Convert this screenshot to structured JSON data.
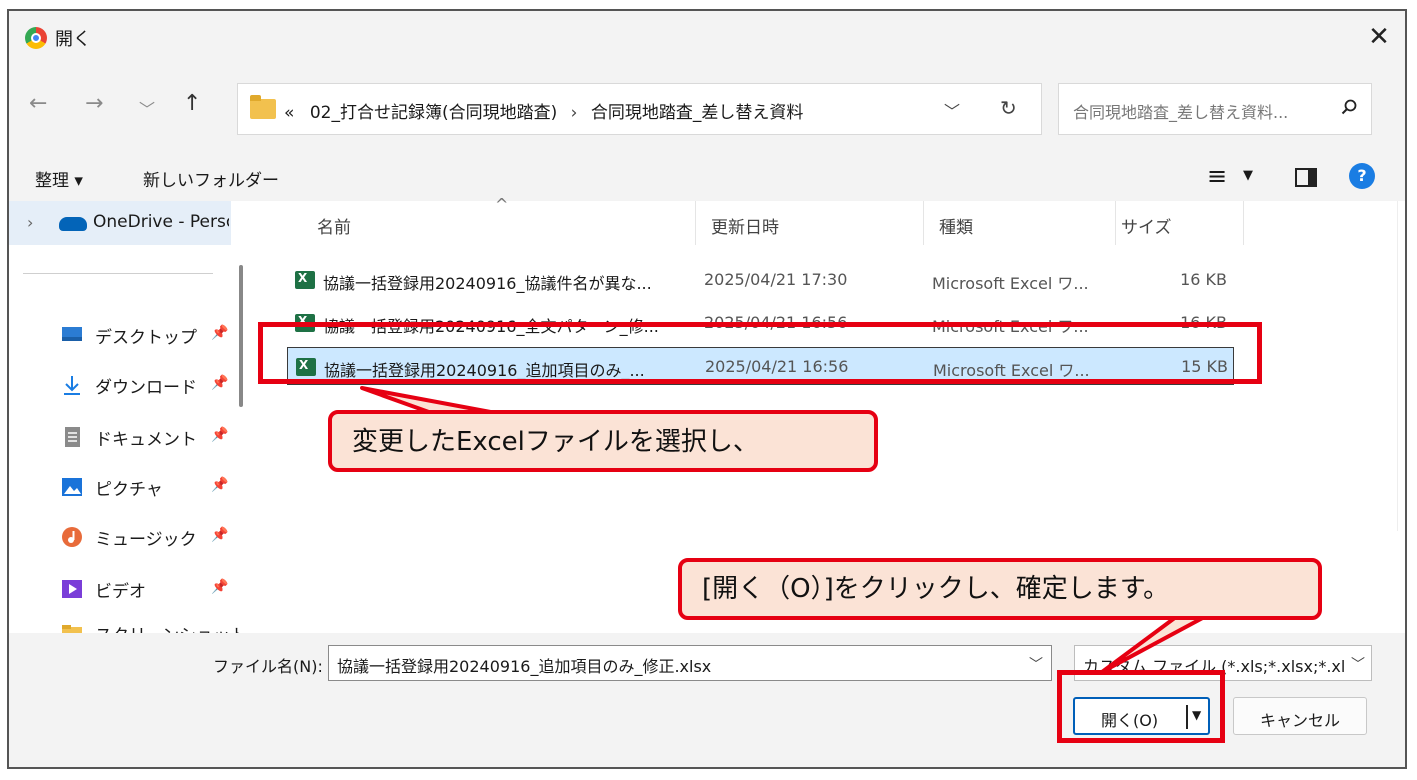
{
  "window": {
    "title": "開く",
    "close_glyph": "✕"
  },
  "nav_buttons": {
    "back": "←",
    "forward": "→",
    "history": "﹀",
    "up": "↑"
  },
  "address": {
    "prefix": "«",
    "crumbs": [
      "02_打合せ記録簿(合同現地踏査)",
      "合同現地踏査_差し替え資料"
    ],
    "separator": "›",
    "dropdown": "﹀",
    "refresh": "↻"
  },
  "search": {
    "placeholder": "合同現地踏査_差し替え資料..."
  },
  "toolbar": {
    "organize": "整理 ▾",
    "new_folder": "新しいフォルダー",
    "view_icon": "≡",
    "view_dropdown": "▼",
    "help": "?"
  },
  "nav_pane": {
    "onedrive_chevron": "›",
    "onedrive": "OneDrive - Personal",
    "quick_access": [
      {
        "label": "デスクトップ",
        "icon": "desktop-icon",
        "color": "#2b7cd3"
      },
      {
        "label": "ダウンロード",
        "icon": "download-icon",
        "color": "#1a7de3"
      },
      {
        "label": "ドキュメント",
        "icon": "documents-icon",
        "color": "#8a8a8a"
      },
      {
        "label": "ピクチャ",
        "icon": "pictures-icon",
        "color": "#1a73d9"
      },
      {
        "label": "ミュージック",
        "icon": "music-icon",
        "color": "#e86b3a"
      },
      {
        "label": "ビデオ",
        "icon": "video-icon",
        "color": "#7a3ed8"
      },
      {
        "label": "スクリーンショット",
        "icon": "folder-icon",
        "color": "#f2c14e"
      }
    ],
    "pin_glyph": "📌"
  },
  "columns": {
    "name": "名前",
    "modified": "更新日時",
    "type": "種類",
    "size": "サイズ",
    "sort_caret": "^"
  },
  "files": [
    {
      "name": "協議一括登録用20240916_協議件名が異な...",
      "modified": "2025/04/21 17:30",
      "type": "Microsoft Excel ワ...",
      "size": "16 KB",
      "selected": false
    },
    {
      "name": "協議一括登録用20240916_全文パターン_修...",
      "modified": "2025/04/21 16:56",
      "type": "Microsoft Excel ワ...",
      "size": "16 KB",
      "selected": false
    },
    {
      "name": "協議一括登録用20240916_追加項目のみ_...",
      "modified": "2025/04/21 16:56",
      "type": "Microsoft Excel ワ...",
      "size": "15 KB",
      "selected": true
    }
  ],
  "bottom": {
    "filename_label": "ファイル名(N):",
    "filename_value": "協議一括登録用20240916_追加項目のみ_修正.xlsx",
    "filetype_value": "カスタム ファイル (*.xls;*.xlsx;*.xlsm",
    "dropdown_glyph": "﹀",
    "open_button": "開く(O)",
    "open_dropdown": "▼",
    "cancel_button": "キャンセル"
  },
  "annotations": {
    "callout1": "変更したExcelファイルを選択し、",
    "callout2": "[開く（O）]をクリックし、確定します。",
    "accent_color": "#e60012",
    "fill_color": "#fbe3d6"
  }
}
